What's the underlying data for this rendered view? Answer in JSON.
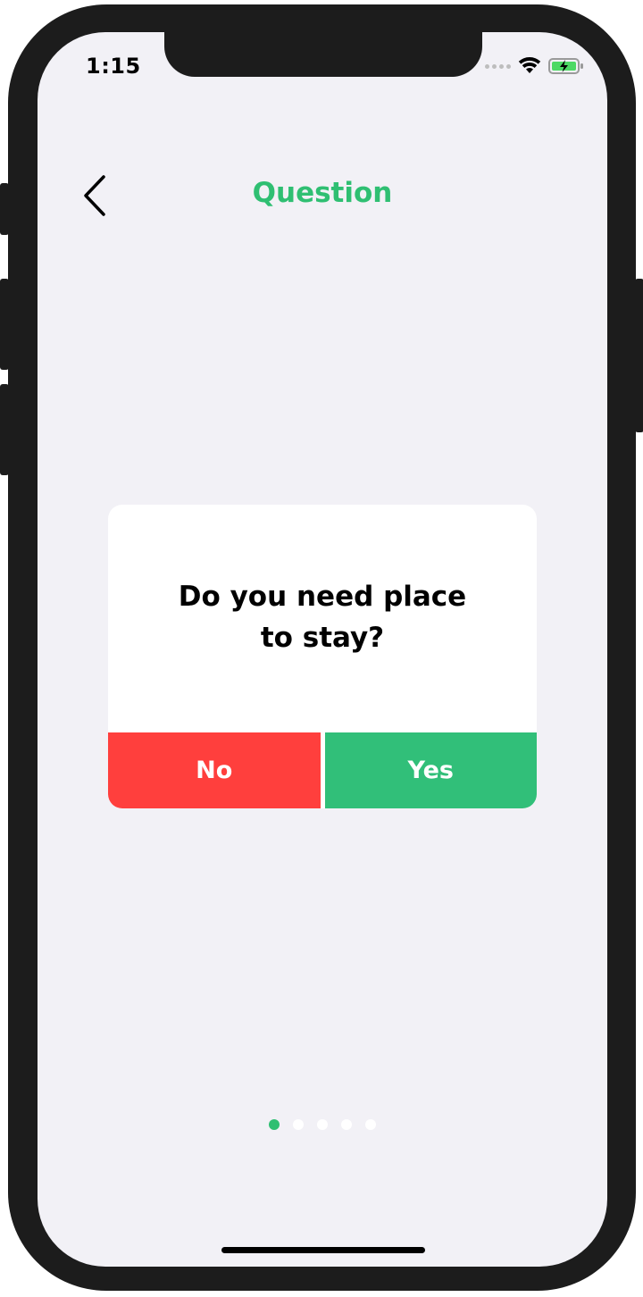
{
  "status_bar": {
    "time": "1:15",
    "battery_color": "#4cd964"
  },
  "nav": {
    "title": "Question",
    "back_icon": "chevron-left-icon"
  },
  "question_card": {
    "question": "Do you need place\nto stay?",
    "no_label": "No",
    "yes_label": "Yes"
  },
  "pagination": {
    "total": 5,
    "current": 1
  },
  "colors": {
    "accent": "#2fbf72",
    "no": "#ff3f3d",
    "yes": "#31bf79",
    "background": "#f2f1f6"
  }
}
